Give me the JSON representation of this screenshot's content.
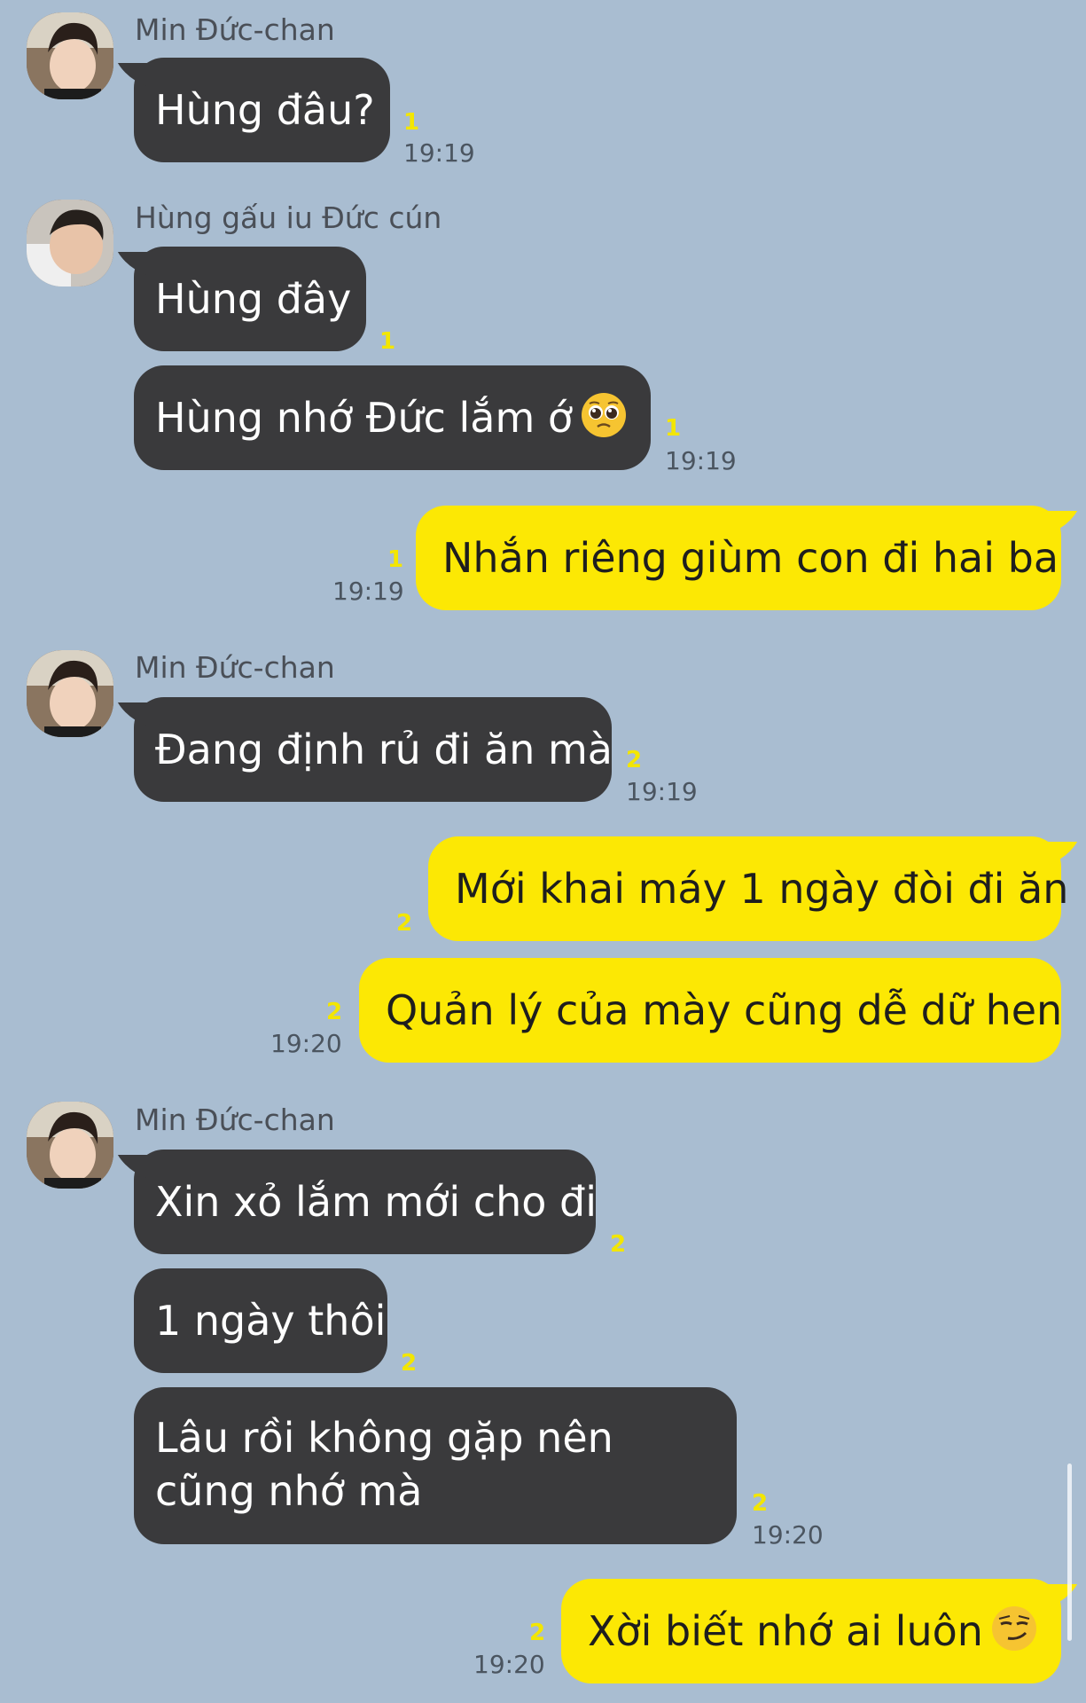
{
  "colors": {
    "background": "#a9bdd1",
    "incoming_bubble": "#3a3a3c",
    "outgoing_bubble": "#fce804",
    "unread": "#f3e600"
  },
  "messages": [
    {
      "sender": "Min Đức-chan",
      "text": "Hùng đâu?",
      "unread": "1",
      "time": "19:19"
    },
    {
      "sender": "Hùng gấu iu Đức cún",
      "text": "Hùng đây",
      "unread": "1"
    },
    {
      "text": "Hùng nhớ Đức lắm ớ",
      "emoji": "pleading-face-icon",
      "unread": "1",
      "time": "19:19"
    },
    {
      "text": "Nhắn riêng giùm con đi hai ba",
      "unread": "1",
      "time": "19:19"
    },
    {
      "sender": "Min Đức-chan",
      "text": "Đang định rủ đi ăn mà",
      "unread": "2",
      "time": "19:19"
    },
    {
      "text": "Mới khai máy 1 ngày đòi đi ăn",
      "unread": "2"
    },
    {
      "text": "Quản lý của mày cũng dễ dữ hen",
      "unread": "2",
      "time": "19:20"
    },
    {
      "sender": "Min Đức-chan",
      "text": "Xin xỏ lắm mới cho đi",
      "unread": "2"
    },
    {
      "text": "1 ngày thôi",
      "unread": "2"
    },
    {
      "text": "Lâu rồi không gặp nên cũng nhớ mà",
      "unread": "2",
      "time": "19:20"
    },
    {
      "text": "Xời biết nhớ ai luôn",
      "emoji": "smirking-face-icon",
      "unread": "2",
      "time": "19:20"
    }
  ]
}
